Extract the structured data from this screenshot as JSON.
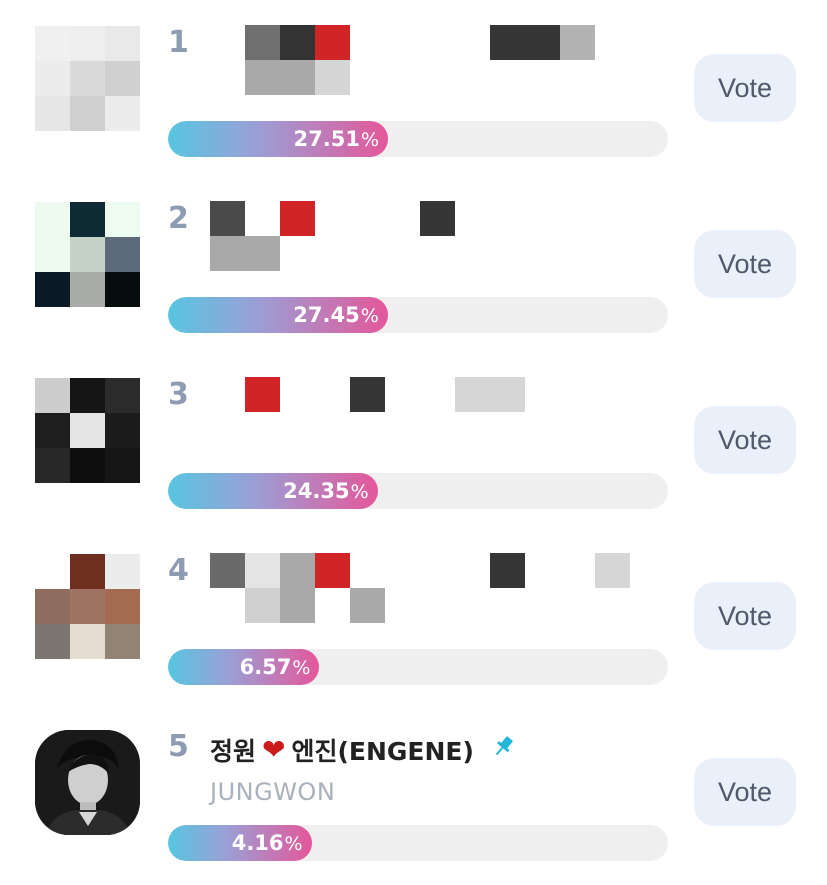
{
  "colors": {
    "rank": "#8e9cb3",
    "vote_bg": "#eaf0fa",
    "bar_gradient": [
      "#57c6e1",
      "#9aa0d6",
      "#e4579a"
    ],
    "track": "#efefef"
  },
  "candidates": [
    {
      "rank": "1",
      "percent": 27.51,
      "percent_label": "27.51",
      "unit": "%",
      "vote_label": "Vote"
    },
    {
      "rank": "2",
      "percent": 27.45,
      "percent_label": "27.45",
      "unit": "%",
      "vote_label": "Vote"
    },
    {
      "rank": "3",
      "percent": 24.35,
      "percent_label": "24.35",
      "unit": "%",
      "vote_label": "Vote"
    },
    {
      "rank": "4",
      "percent": 6.57,
      "percent_label": "6.57",
      "unit": "%",
      "vote_label": "Vote"
    },
    {
      "rank": "5",
      "name": "정원",
      "fandom": "엔진(ENGENE)",
      "subtitle": "JUNGWON",
      "icons": [
        "heart-icon",
        "pin-icon"
      ],
      "percent": 4.16,
      "percent_label": "4.16",
      "unit": "%",
      "vote_label": "Vote"
    }
  ]
}
